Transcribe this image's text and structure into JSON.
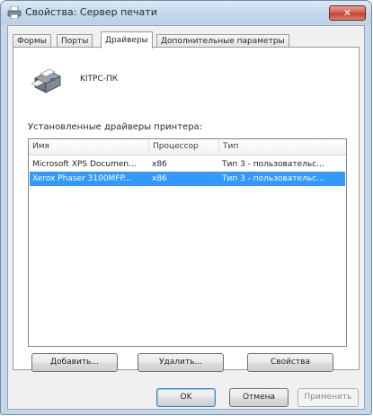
{
  "window": {
    "title": "Свойства: Сервер печати",
    "close_label": "✕"
  },
  "tabs": [
    {
      "label": "Формы"
    },
    {
      "label": "Порты"
    },
    {
      "label": "Драйверы"
    },
    {
      "label": "Дополнительные параметры"
    }
  ],
  "active_tab": "Драйверы",
  "server": {
    "name": "KITPC-ПК"
  },
  "drivers": {
    "label": "Установленные драйверы принтера:",
    "columns": [
      "Имя",
      "Процессор",
      "Тип"
    ],
    "rows": [
      {
        "name": "Microsoft XPS Documen...",
        "processor": "x86",
        "type": "Тип 3 - пользовательс...",
        "selected": false
      },
      {
        "name": "Xerox Phaser 3100MFP...",
        "processor": "x86",
        "type": "Тип 3 - пользовательс...",
        "selected": true
      }
    ],
    "selection_color": "#3399ff"
  },
  "buttons": {
    "add": "Добавить...",
    "remove": "Удалить...",
    "properties": "Свойства",
    "ok": "OK",
    "cancel": "Отмена",
    "apply": "Применить"
  }
}
